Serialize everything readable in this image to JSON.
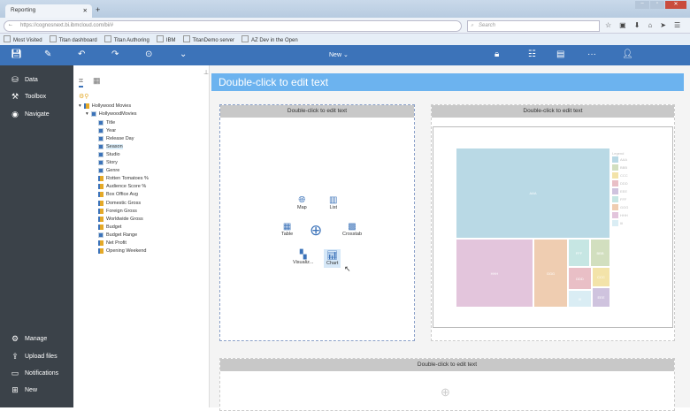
{
  "browser": {
    "tab_title": "Reporting",
    "url": "https://cognosnext.bi.ibmcloud.com/bi/#",
    "search_placeholder": "Search",
    "bookmarks": [
      "Most Visited",
      "Titan dashboard",
      "Titan Authoring",
      "IBM",
      "TitanDemo server",
      "AZ Dev in the Open"
    ]
  },
  "toolbar": {
    "new_label": "New"
  },
  "sidebar": {
    "top": [
      {
        "label": "Data",
        "icon": "database-icon"
      },
      {
        "label": "Toolbox",
        "icon": "hammer-icon"
      },
      {
        "label": "Navigate",
        "icon": "compass-icon"
      }
    ],
    "bottom": [
      {
        "label": "Manage",
        "icon": "gear-icon"
      },
      {
        "label": "Upload files",
        "icon": "upload-icon"
      },
      {
        "label": "Notifications",
        "icon": "chat-icon"
      },
      {
        "label": "New",
        "icon": "plus-icon"
      }
    ]
  },
  "source": {
    "package": "Hollywood Movies",
    "table": "HollywoodMovies",
    "fields": [
      {
        "label": "Title",
        "type": "attr"
      },
      {
        "label": "Year",
        "type": "attr"
      },
      {
        "label": "Release Day",
        "type": "attr"
      },
      {
        "label": "Season",
        "type": "attr",
        "selected": true
      },
      {
        "label": "Studio",
        "type": "attr"
      },
      {
        "label": "Story",
        "type": "attr"
      },
      {
        "label": "Genre",
        "type": "attr"
      },
      {
        "label": "Rotten Tomatoes %",
        "type": "measure"
      },
      {
        "label": "Audience Score %",
        "type": "measure"
      },
      {
        "label": "Box Office Avg",
        "type": "measure"
      },
      {
        "label": "Domestic Gross",
        "type": "measure"
      },
      {
        "label": "Foreign Gross",
        "type": "measure"
      },
      {
        "label": "Worldwide Gross",
        "type": "measure"
      },
      {
        "label": "Budget",
        "type": "measure"
      },
      {
        "label": "Budget Range",
        "type": "attr"
      },
      {
        "label": "Net Profit",
        "type": "measure"
      },
      {
        "label": "Opening Weekend",
        "type": "measure"
      }
    ]
  },
  "report": {
    "header": "Double-click to edit text",
    "left_block_title": "Double-click to edit text",
    "right_block_title": "Double-click to edit text",
    "bottom_block_title": "Double-click to edit text",
    "insert_options": [
      "Map",
      "List",
      "Table",
      "Crosstab",
      "Visualiz...",
      "Chart"
    ]
  },
  "chart_data": {
    "type": "treemap",
    "legend_title": "Legend",
    "legend_position": "right",
    "items": [
      {
        "label": "AAA",
        "value": 100,
        "color": "#b9d9e5"
      },
      {
        "label": "BBB",
        "value": 4.1,
        "color": "#d2dfbf"
      },
      {
        "label": "CCC",
        "value": 2.7,
        "color": "#f3e3a9"
      },
      {
        "label": "DDD",
        "value": 3.9,
        "color": "#e9bfc6"
      },
      {
        "label": "EEE",
        "value": 2.7,
        "color": "#cfc3de"
      },
      {
        "label": "FFF",
        "value": 4.4,
        "color": "#c6e6e3"
      },
      {
        "label": "GGG",
        "value": 17,
        "color": "#efcdb1"
      },
      {
        "label": "HHH",
        "value": 38,
        "color": "#e3c5dc"
      },
      {
        "label": "III",
        "value": 3,
        "color": "#daedf4"
      }
    ]
  }
}
